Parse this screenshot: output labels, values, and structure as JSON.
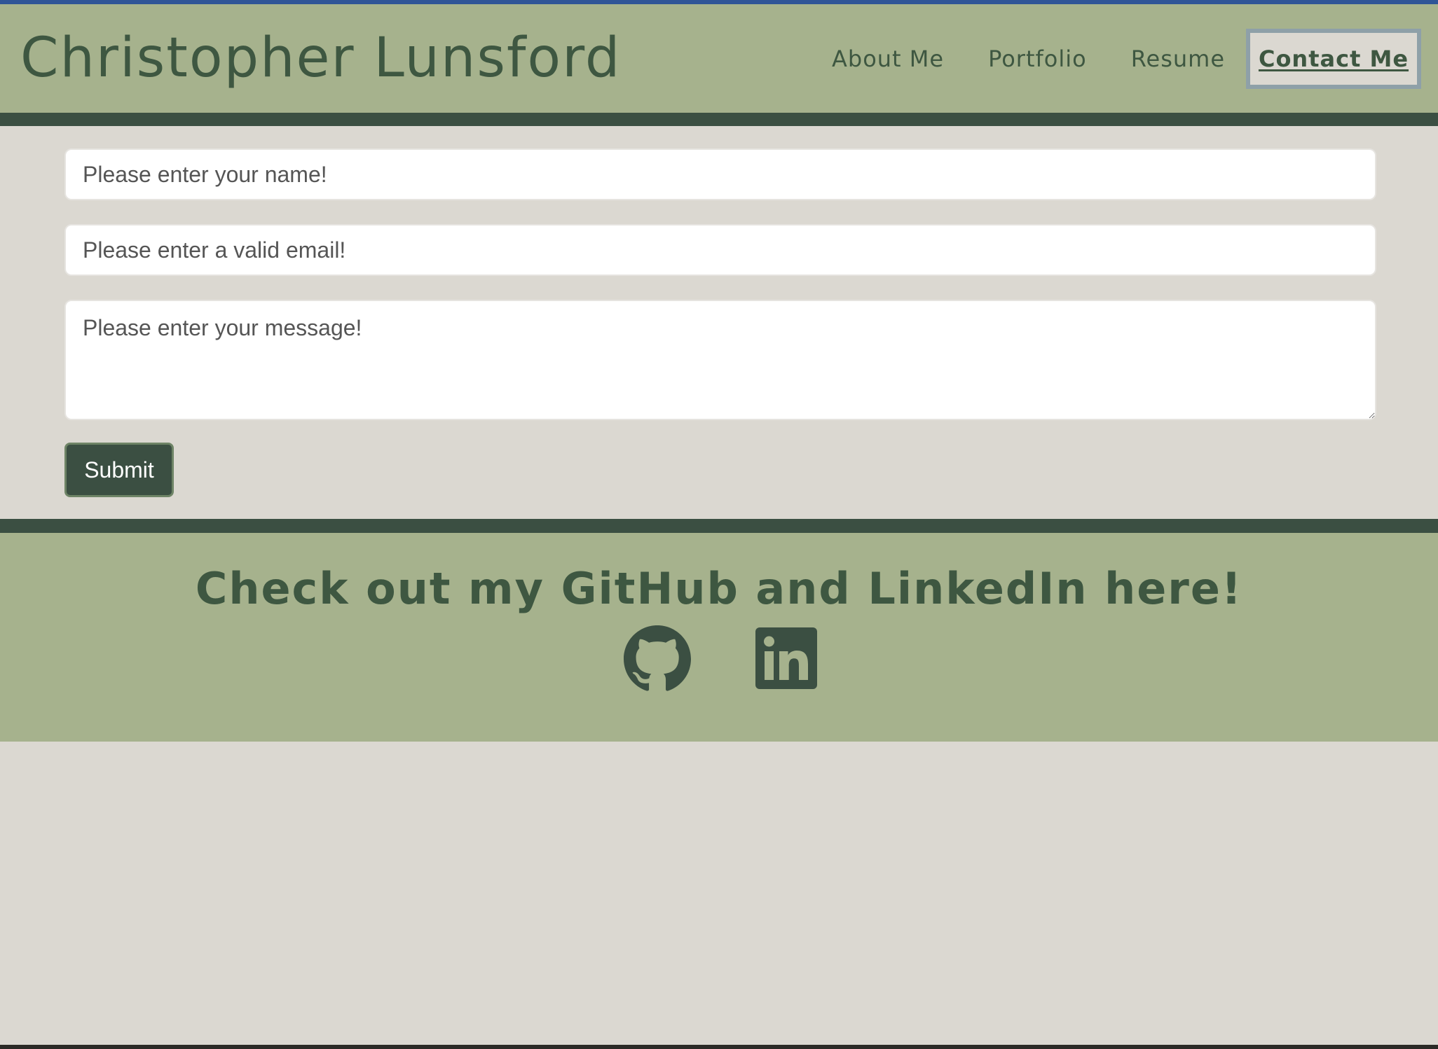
{
  "header": {
    "site_title": "Christopher Lunsford",
    "nav": {
      "about": "About Me",
      "portfolio": "Portfolio",
      "resume": "Resume",
      "contact": "Contact Me"
    },
    "active_nav": "Contact Me"
  },
  "contact_form": {
    "name_placeholder": "Please enter your name!",
    "email_placeholder": "Please enter a valid email!",
    "message_placeholder": "Please enter your message!",
    "submit_label": "Submit"
  },
  "footer": {
    "heading": "Check out my GitHub and LinkedIn here!",
    "links": [
      {
        "icon": "github-icon"
      },
      {
        "icon": "linkedin-icon"
      }
    ]
  },
  "colors": {
    "header_bg": "#a6b28d",
    "dark_green": "#3b4f42",
    "text_green": "#3e5741",
    "page_bg": "#dbd8d1",
    "active_border": "#8ea0a8",
    "top_strip": "#2f5597"
  }
}
